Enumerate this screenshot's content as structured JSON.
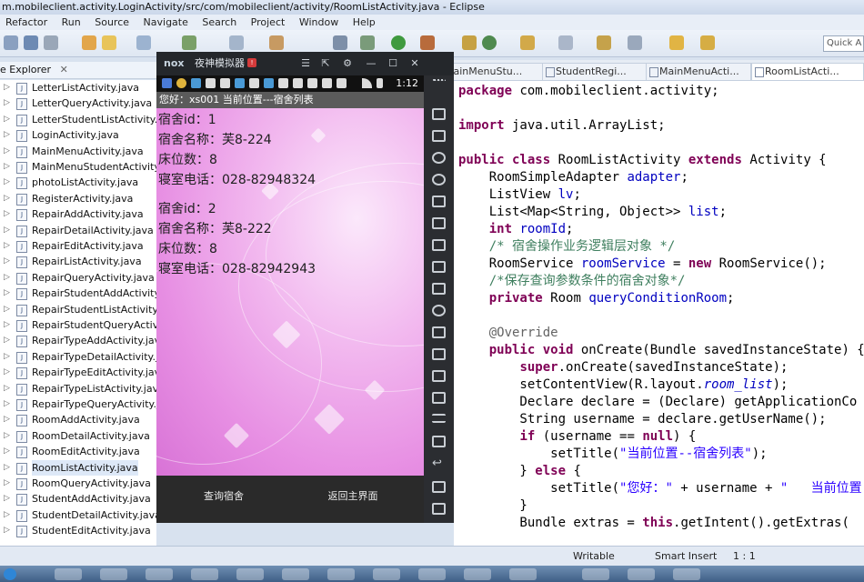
{
  "window": {
    "title": "m.mobileclient.activity.LoginActivity/src/com/mobileclient/activity/RoomListActivity.java - Eclipse"
  },
  "menu": [
    "Refactor",
    "Run",
    "Source",
    "Navigate",
    "Search",
    "Project",
    "Window",
    "Help"
  ],
  "toolbar": {
    "quick_access": "Quick A"
  },
  "package_explorer": {
    "title": "e Explorer",
    "items": [
      {
        "label": "LetterListActivity.java"
      },
      {
        "label": "LetterQueryActivity.java"
      },
      {
        "label": "LetterStudentListActivity.jav"
      },
      {
        "label": "LoginActivity.java"
      },
      {
        "label": "MainMenuActivity.java"
      },
      {
        "label": "MainMenuStudentActivity.ja"
      },
      {
        "label": "photoListActivity.java"
      },
      {
        "label": "RegisterActivity.java"
      },
      {
        "label": "RepairAddActivity.java"
      },
      {
        "label": "RepairDetailActivity.java"
      },
      {
        "label": "RepairEditActivity.java"
      },
      {
        "label": "RepairListActivity.java"
      },
      {
        "label": "RepairQueryActivity.java"
      },
      {
        "label": "RepairStudentAddActivity.ja"
      },
      {
        "label": "RepairStudentListActivity.ja"
      },
      {
        "label": "RepairStudentQueryActivity"
      },
      {
        "label": "RepairTypeAddActivity.java"
      },
      {
        "label": "RepairTypeDetailActivity.jav"
      },
      {
        "label": "RepairTypeEditActivity.java"
      },
      {
        "label": "RepairTypeListActivity.java"
      },
      {
        "label": "RepairTypeQueryActivity.jav"
      },
      {
        "label": "RoomAddActivity.java"
      },
      {
        "label": "RoomDetailActivity.java"
      },
      {
        "label": "RoomEditActivity.java"
      },
      {
        "label": "RoomListActivity.java",
        "selected": true
      },
      {
        "label": "RoomQueryActivity.java"
      },
      {
        "label": "StudentAddActivity.java"
      },
      {
        "label": "StudentDetailActivity.java"
      },
      {
        "label": "StudentEditActivity.java"
      }
    ]
  },
  "emulator": {
    "logo": "nox",
    "title": "夜神模拟器",
    "time": "1:12",
    "app_title": "您好：xs001   当前位置---宿舍列表",
    "rooms": [
      {
        "id": "宿舍id：1",
        "name": "宿舍名称：芙8-224",
        "beds": "床位数：8",
        "phone": "寝室电话：028-82948324"
      },
      {
        "id": "宿舍id：2",
        "name": "宿舍名称：芙8-222",
        "beds": "床位数：8",
        "phone": "寝室电话：028-82942943"
      }
    ],
    "buttons": {
      "query": "查询宿舍",
      "back": "返回主界面"
    }
  },
  "editor": {
    "tabs": [
      {
        "label": "MainMenuStu..."
      },
      {
        "label": "StudentRegi..."
      },
      {
        "label": "MainMenuActi..."
      },
      {
        "label": "RoomListActi...",
        "active": true
      }
    ]
  },
  "status": {
    "writable": "Writable",
    "insert": "Smart Insert",
    "position": "1 : 1"
  }
}
